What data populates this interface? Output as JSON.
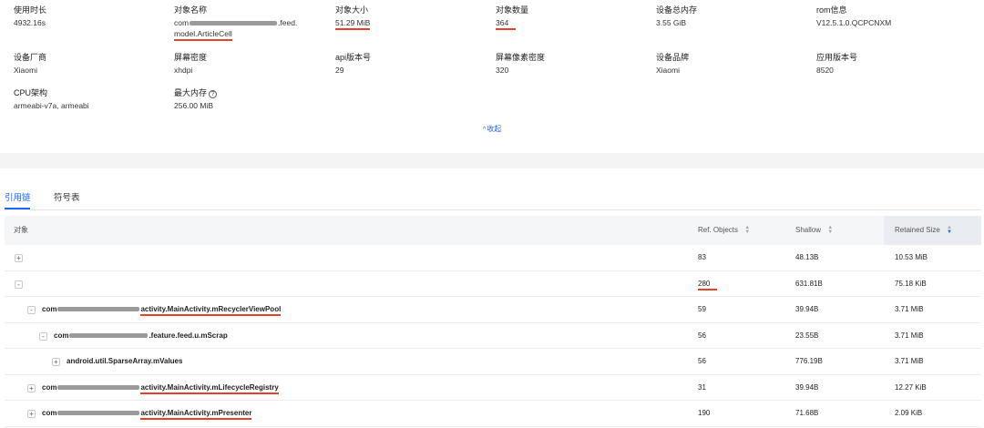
{
  "info": {
    "items": [
      {
        "label": "使用时长",
        "value": "4932.16s"
      },
      {
        "label": "对象名称",
        "value_prefix": "com",
        "value_suffix": ".feed.",
        "value_line2": "model.ArticleCell"
      },
      {
        "label": "对象大小",
        "value": "51.29 MiB"
      },
      {
        "label": "对象数量",
        "value": "364"
      },
      {
        "label": "设备总内存",
        "value": "3.55 GiB"
      },
      {
        "label": "rom信息",
        "value": "V12.5.1.0.QCPCNXM"
      },
      {
        "label": "设备厂商",
        "value": "Xiaomi"
      },
      {
        "label": "屏幕密度",
        "value": "xhdpi"
      },
      {
        "label": "api版本号",
        "value": "29"
      },
      {
        "label": "屏幕像素密度",
        "value": "320"
      },
      {
        "label": "设备品牌",
        "value": "Xiaomi"
      },
      {
        "label": "应用版本号",
        "value": "8520"
      },
      {
        "label": "CPU架构",
        "value": "armeabi-v7a, armeabi"
      },
      {
        "label": "最大内存",
        "value": "256.00 MiB"
      }
    ],
    "collapse_label": "收起"
  },
  "tabs": [
    {
      "label": "引用链",
      "active": true
    },
    {
      "label": "符号表",
      "active": false
    }
  ],
  "table": {
    "headers": {
      "object": "对象",
      "ref_objects": "Ref. Objects",
      "shallow": "Shallow",
      "retained": "Retained Size"
    },
    "rows": [
      {
        "expander": "+",
        "prefix": "",
        "name": "",
        "ref": "83",
        "shallow": "48.13B",
        "retained": "10.53 MiB"
      },
      {
        "expander": "-",
        "prefix": "",
        "name": "",
        "ref": "280",
        "shallow": "631.81B",
        "retained": "75.18 KiB"
      },
      {
        "expander": "-",
        "prefix": "com",
        "mid": "activity.",
        "name": "MainActivity.mRecyclerViewPool",
        "ref": "59",
        "shallow": "39.94B",
        "retained": "3.71 MiB"
      },
      {
        "expander": "-",
        "prefix": "com",
        "mid": ".feature.feed.u.mScrap",
        "name": "",
        "ref": "56",
        "shallow": "23.55B",
        "retained": "3.71 MiB"
      },
      {
        "expander": "+",
        "prefix": "android.util.SparseArray.mValues",
        "mid": "",
        "name": "",
        "ref": "56",
        "shallow": "776.19B",
        "retained": "3.71 MiB"
      },
      {
        "expander": "+",
        "prefix": "com",
        "mid": "activity.",
        "name": "MainActivity.mLifecycleRegistry",
        "ref": "31",
        "shallow": "39.94B",
        "retained": "12.27 KiB"
      },
      {
        "expander": "+",
        "prefix": "com",
        "mid": "activity.",
        "name": "MainActivity.mPresenter",
        "ref": "190",
        "shallow": "71.68B",
        "retained": "2.09 KiB"
      }
    ]
  }
}
